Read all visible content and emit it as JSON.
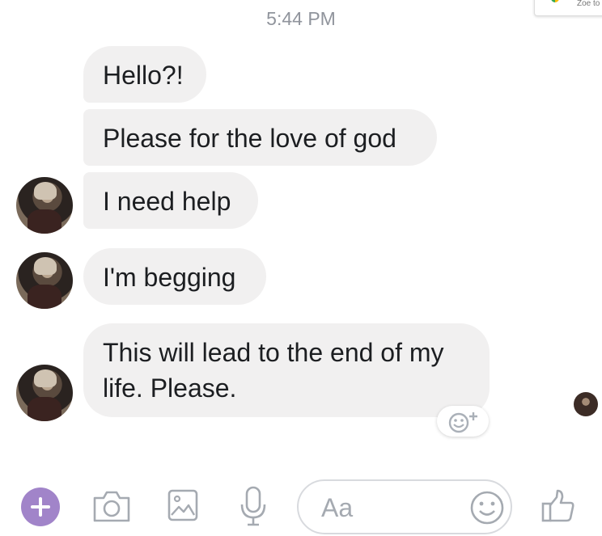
{
  "header": {
    "timestamp": "5:44 PM",
    "corner_tab_text": "Zoe to"
  },
  "messages": [
    {
      "lines": [
        "Hello?!"
      ]
    },
    {
      "lines": [
        "Please for the love of god"
      ]
    },
    {
      "lines": [
        "I need help"
      ]
    },
    {
      "lines": [
        "I'm begging"
      ]
    },
    {
      "lines": [
        "This will lead to the end of my",
        "life. Please."
      ]
    }
  ],
  "composer": {
    "placeholder": "Aa"
  },
  "icons": {
    "add": "plus-icon",
    "camera": "camera-icon",
    "gallery": "image-icon",
    "voice": "microphone-icon",
    "emoji": "smiley-icon",
    "like": "thumbs-up-icon",
    "reaction": "add-reaction-icon"
  },
  "colors": {
    "accent": "#a184c9",
    "bubble": "#f1f0f0",
    "icon": "#a5aab1",
    "timestamp": "#90949c"
  }
}
